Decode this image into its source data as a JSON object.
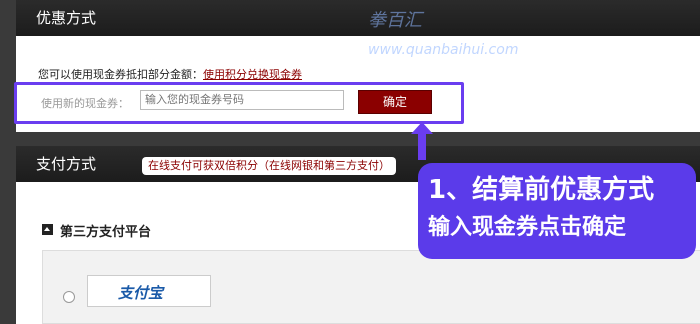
{
  "coupon_panel": {
    "title": "优惠方式",
    "hint_text": "您可以使用现金券抵扣部分金额：",
    "hint_link": "使用积分兑换现金券",
    "new_coupon_label": "使用新的现金券：",
    "coupon_input_placeholder": "输入您的现金券号码",
    "confirm_button": "确定"
  },
  "watermark": {
    "line1": "拳百汇",
    "line2": "www.quanbaihui.com"
  },
  "payment_panel": {
    "title": "支付方式",
    "tag_text": "在线支付可获双倍积分（在线网银和第三方支付）",
    "section_title": "第三方支付平台",
    "alipay_label": "支付宝"
  },
  "annotation": {
    "line1": "1、结算前优惠方式",
    "line2": "输入现金券点击确定"
  },
  "colors": {
    "accent_highlight": "#6a3df0",
    "annotation_bg": "#5b3bea",
    "confirm_bg": "#8b0000",
    "link": "#8b0000"
  }
}
